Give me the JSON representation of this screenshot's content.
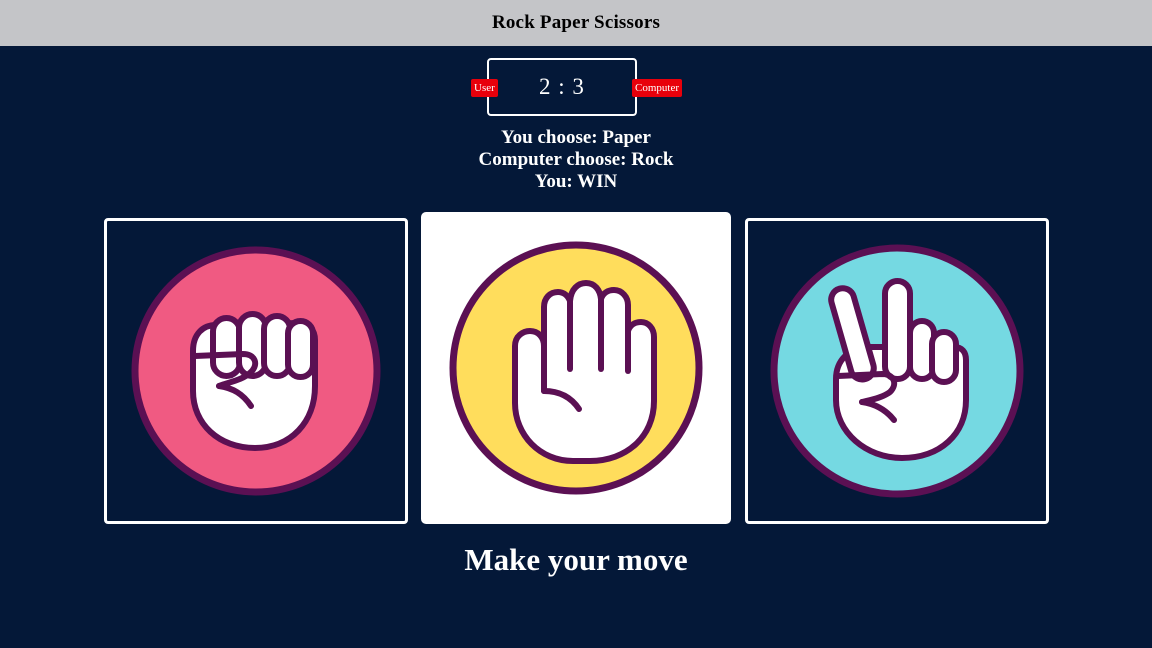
{
  "header": {
    "title": "Rock Paper Scissors"
  },
  "scoreboard": {
    "score": "2 : 3",
    "user_label": "User",
    "computer_label": "Computer"
  },
  "result": {
    "user_choice": "You choose: Paper",
    "computer_choice": "Computer choose: Rock",
    "outcome": "You: WIN"
  },
  "choices": [
    {
      "name": "rock",
      "color": "#f05a82",
      "selected": false
    },
    {
      "name": "paper",
      "color": "#ffdd5c",
      "selected": true
    },
    {
      "name": "scissors",
      "color": "#75d9e2",
      "selected": false
    }
  ],
  "colors": {
    "background": "#041838",
    "header": "#c4c5c8",
    "badge": "#e8000b",
    "outline": "#5b1053"
  },
  "footer": {
    "prompt": "Make your move"
  }
}
